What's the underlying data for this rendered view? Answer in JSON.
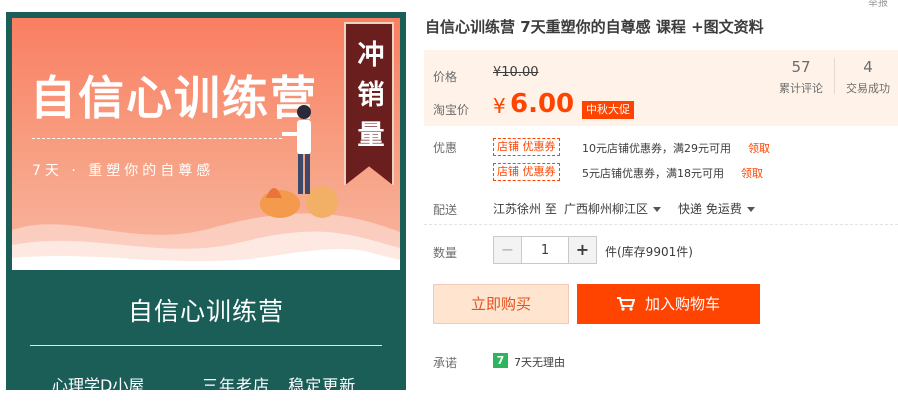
{
  "top_fragment": "举报",
  "image": {
    "banner_title": "自信心训练营",
    "banner_sub": "7天 · 重塑你的自尊感",
    "ribbon": "冲销量",
    "course_title": "自信心训练营",
    "shop_name": "心理学D小屋",
    "shop_tag": "三年老店   稳定更新"
  },
  "product": {
    "title": "自信心训练营 7天重塑你的自尊感 课程 +图文资料"
  },
  "price": {
    "label": "价格",
    "original": "¥10.00",
    "taobao_label": "淘宝价",
    "currency": "¥",
    "current": "6.00",
    "promo_badge": "中秋大促"
  },
  "stats": {
    "reviews_count": "57",
    "reviews_label": "累计评论",
    "sales_count": "4",
    "sales_label": "交易成功"
  },
  "coupons": {
    "label": "优惠",
    "items": [
      {
        "tag": "店铺 优惠券",
        "text": "10元店铺优惠券，满29元可用",
        "link": "领取"
      },
      {
        "tag": "店铺 优惠券",
        "text": "5元店铺优惠券，满18元可用",
        "link": "领取"
      }
    ]
  },
  "shipping": {
    "label": "配送",
    "from": "江苏徐州 至",
    "to": "广西柳州柳江区",
    "method": "快递 免运费"
  },
  "quantity": {
    "label": "数量",
    "minus": "−",
    "value": "1",
    "plus": "+",
    "stock": "件(库存9901件)"
  },
  "actions": {
    "buy_now": "立即购买",
    "add_cart": "加入购物车"
  },
  "promise": {
    "label": "承诺",
    "icon_text": "7",
    "text": "7天无理由"
  },
  "colors": {
    "accent": "#ff4400",
    "price_bg": "#fff2e8",
    "image_bg": "#1b5e58",
    "promise_green": "#2db55d"
  },
  "icons": [
    "cart-icon",
    "caret-down-icon",
    "seven-day-icon"
  ]
}
